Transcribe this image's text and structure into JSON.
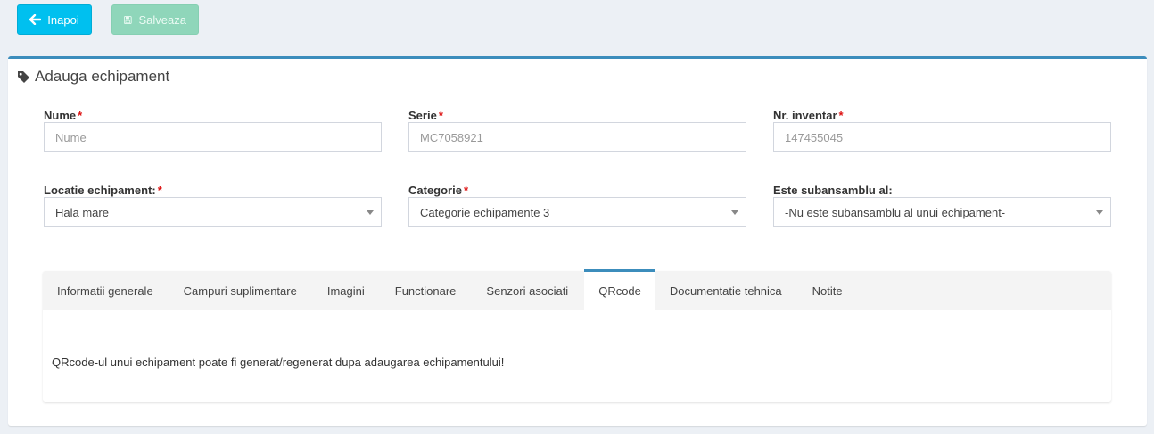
{
  "toolbar": {
    "back_label": "Inapoi",
    "save_label": "Salveaza"
  },
  "panel": {
    "title": "Adauga echipament"
  },
  "form": {
    "nume": {
      "label": "Nume",
      "required": "*",
      "placeholder": "Nume",
      "value": ""
    },
    "serie": {
      "label": "Serie",
      "required": "*",
      "value": "MC7058921"
    },
    "inventar": {
      "label": "Nr. inventar",
      "required": "*",
      "value": "147455045"
    },
    "locatie": {
      "label": "Locatie echipament:",
      "required": "*",
      "selected": "Hala mare"
    },
    "categorie": {
      "label": "Categorie",
      "required": "*",
      "selected": "Categorie echipamente 3"
    },
    "subansamblu": {
      "label": "Este subansamblu al:",
      "selected": "-Nu este subansamblu al unui echipament-"
    }
  },
  "tabs": [
    {
      "label": "Informatii generale"
    },
    {
      "label": "Campuri suplimentare"
    },
    {
      "label": "Imagini"
    },
    {
      "label": "Functionare"
    },
    {
      "label": "Senzori asociati"
    },
    {
      "label": "QRcode"
    },
    {
      "label": "Documentatie tehnica"
    },
    {
      "label": "Notite"
    }
  ],
  "active_tab": "QRcode",
  "tab_content": {
    "message": "QRcode-ul unui echipament poate fi generat/regenerat dupa adaugarea echipamentului!"
  },
  "colors": {
    "primary": "#3c8dbc",
    "info": "#00c0ef",
    "success_disabled": "#8fd6ba",
    "required": "#dd1111"
  },
  "icons": {
    "back": "arrow-left-icon",
    "save": "floppy-disk-icon",
    "title": "tag-icon"
  }
}
